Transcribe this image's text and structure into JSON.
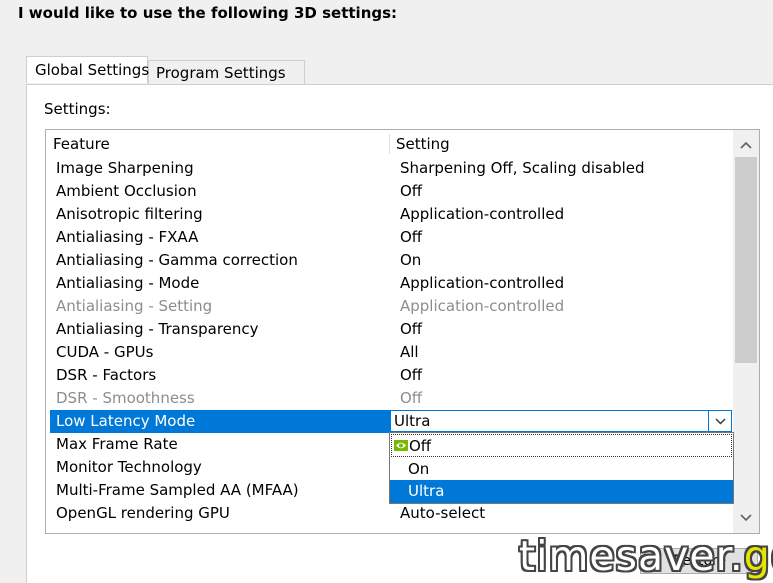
{
  "heading": "I would like to use the following 3D settings:",
  "tabs": [
    {
      "label": "Global Settings",
      "active": true
    },
    {
      "label": "Program Settings",
      "active": false
    }
  ],
  "settings_label": "Settings:",
  "columns": {
    "feature": "Feature",
    "setting": "Setting"
  },
  "rows": [
    {
      "feature": "Image Sharpening",
      "setting": "Sharpening Off, Scaling disabled"
    },
    {
      "feature": "Ambient Occlusion",
      "setting": "Off"
    },
    {
      "feature": "Anisotropic filtering",
      "setting": "Application-controlled"
    },
    {
      "feature": "Antialiasing - FXAA",
      "setting": "Off"
    },
    {
      "feature": "Antialiasing - Gamma correction",
      "setting": "On"
    },
    {
      "feature": "Antialiasing - Mode",
      "setting": "Application-controlled"
    },
    {
      "feature": "Antialiasing - Setting",
      "setting": "Application-controlled",
      "disabled": true
    },
    {
      "feature": "Antialiasing - Transparency",
      "setting": "Off"
    },
    {
      "feature": "CUDA - GPUs",
      "setting": "All"
    },
    {
      "feature": "DSR - Factors",
      "setting": "Off"
    },
    {
      "feature": "DSR - Smoothness",
      "setting": "Off",
      "disabled": true
    },
    {
      "feature": "Low Latency Mode",
      "setting": "Ultra",
      "selected": true
    },
    {
      "feature": "Max Frame Rate",
      "setting": ""
    },
    {
      "feature": "Monitor Technology",
      "setting": ""
    },
    {
      "feature": "Multi-Frame Sampled AA (MFAA)",
      "setting": ""
    },
    {
      "feature": "OpenGL rendering GPU",
      "setting": "Auto-select"
    }
  ],
  "dropdown": {
    "options": [
      {
        "label": "Off",
        "icon": "nvidia-icon"
      },
      {
        "label": "On"
      },
      {
        "label": "Ultra",
        "highlighted": true
      }
    ]
  },
  "restore_button": {
    "label": "Restore"
  },
  "watermark": {
    "text": "timesaver.",
    "accent": "gg"
  },
  "colors": {
    "selection": "#0078d7",
    "disabled_text": "#8d8d8d",
    "watermark_accent": "#e6e600"
  }
}
